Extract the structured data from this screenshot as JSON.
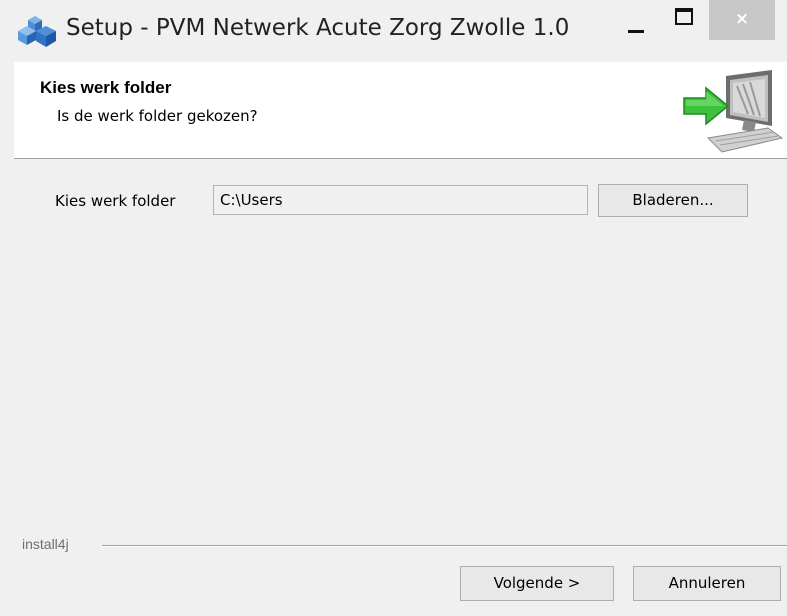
{
  "window": {
    "title": "Setup - PVM Netwerk Acute Zorg Zwolle 1.0",
    "close_label": "×",
    "icon": "setup-app-icon",
    "close_bg": "#c7c7c7"
  },
  "header": {
    "title": "Kies werk folder",
    "subtitle": "Is de werk folder gekozen?",
    "graphic": "computer-arrow-icon"
  },
  "form": {
    "folder_label": "Kies werk folder",
    "folder_value": "C:\\Users",
    "browse_label": "Bladeren..."
  },
  "footer": {
    "brand": "install4j",
    "next_label": "Volgende >",
    "cancel_label": "Annuleren"
  },
  "colors": {
    "accent_arrow": "#3cc23c",
    "window_bg": "#f0f0f0"
  }
}
